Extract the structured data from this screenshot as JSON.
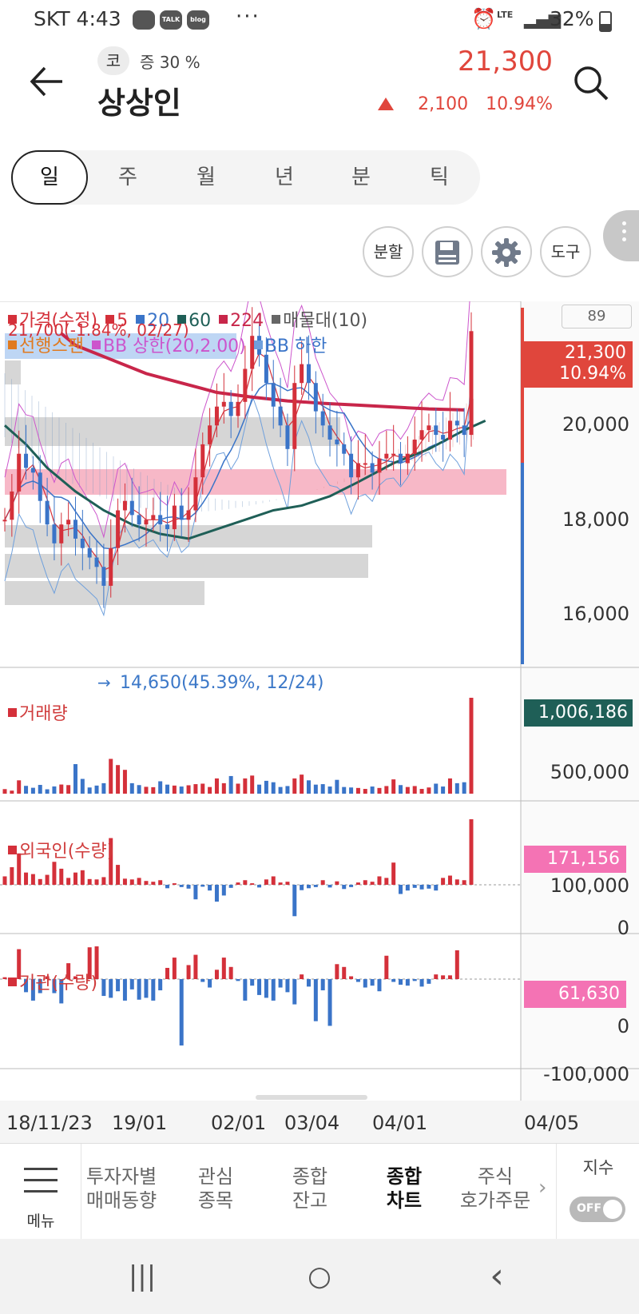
{
  "status_bar": {
    "carrier_time": "SKT 4:43",
    "icons": [
      "chat-icon",
      "kakaotalk-icon",
      "blog-icon",
      "more-icon",
      "alarm-icon",
      "lte-icon",
      "signal-icon",
      "battery-icon"
    ],
    "talk": "TALK",
    "blog": "blog",
    "dots": "···",
    "network": "LTE",
    "battery": "32%"
  },
  "header": {
    "market_badge": "코",
    "margin_text": "증 30 %",
    "stock_name": "상상인",
    "price": "21,300",
    "change": "2,100",
    "change_pct": "10.94%",
    "accent_color": "#e0463c"
  },
  "period_tabs": [
    {
      "label": "일",
      "active": true
    },
    {
      "label": "주",
      "active": false
    },
    {
      "label": "월",
      "active": false
    },
    {
      "label": "년",
      "active": false
    },
    {
      "label": "분",
      "active": false
    },
    {
      "label": "틱",
      "active": false
    }
  ],
  "tools": {
    "split": "분할",
    "save_icon": "save-icon",
    "settings_icon": "gear-icon",
    "tool": "도구"
  },
  "chart": {
    "period_count": "89",
    "legend": {
      "price": "가격(수정)",
      "ma5": "5",
      "ma20": "20",
      "ma60": "60",
      "ma224": "224",
      "volume_profile": "매물대(10)",
      "leading_span": "선행스팬",
      "bb_upper": "BB 상한(20,2.00)",
      "bb_lower": "BB 하한",
      "high_marker": "21,700(-1.84%, 02/27)"
    },
    "low_marker": "14,650(45.39%, 12/24)",
    "price_tag": {
      "price": "21,300",
      "pct": "10.94%"
    },
    "price_axis": [
      "20,000",
      "18,000",
      "16,000"
    ],
    "volume_title": "거래량",
    "volume_tag": "1,006,186",
    "volume_axis": [
      "500,000"
    ],
    "foreign_title": "외국인(수량)",
    "foreign_tag": "171,156",
    "foreign_axis": [
      "100,000",
      "0"
    ],
    "inst_title": "기관(수량)",
    "inst_tag": "61,630",
    "inst_axis": [
      "0",
      "-100,000"
    ],
    "dates": [
      "18/11/23",
      "19/01",
      "02/01",
      "03/04",
      "04/01",
      "04/05"
    ]
  },
  "chart_data": {
    "type": "bar",
    "price_range": [
      14500,
      22500
    ],
    "closes": [
      17300,
      17900,
      18700,
      18400,
      18300,
      17700,
      17200,
      16800,
      17200,
      17300,
      16900,
      16700,
      16500,
      16300,
      15900,
      16700,
      17500,
      17700,
      17400,
      17200,
      17300,
      17400,
      17200,
      17100,
      17600,
      17300,
      17500,
      18200,
      18900,
      19300,
      19700,
      19800,
      19500,
      19800,
      20500,
      21200,
      20800,
      20200,
      19700,
      19300,
      18800,
      20200,
      20600,
      20200,
      19600,
      19300,
      19000,
      18900,
      18700,
      18200,
      18500,
      18500,
      18300,
      18600,
      18700,
      18700,
      18500,
      18700,
      19000,
      19200,
      19300,
      19100,
      19000,
      19400,
      19300,
      19100,
      21300
    ],
    "volume": [
      48000,
      32000,
      140000,
      82000,
      62000,
      92000,
      46000,
      76000,
      96000,
      90000,
      310000,
      155000,
      65000,
      85000,
      110000,
      365000,
      300000,
      250000,
      110000,
      90000,
      72000,
      68000,
      130000,
      95000,
      85000,
      75000,
      88000,
      100000,
      105000,
      70000,
      160000,
      110000,
      185000,
      105000,
      160000,
      190000,
      95000,
      135000,
      120000,
      70000,
      80000,
      160000,
      200000,
      140000,
      95000,
      100000,
      75000,
      145000,
      70000,
      65000,
      60000,
      50000,
      75000,
      60000,
      80000,
      150000,
      90000,
      70000,
      80000,
      50000,
      65000,
      105000,
      75000,
      160000,
      110000,
      120000,
      1006186
    ],
    "foreign": [
      22000,
      46000,
      82000,
      32000,
      28000,
      15000,
      26000,
      60000,
      42000,
      18000,
      32000,
      38000,
      15000,
      14000,
      20000,
      122000,
      52000,
      16000,
      14000,
      18000,
      10000,
      8000,
      12000,
      -9000,
      4000,
      -6000,
      -10000,
      -38000,
      -5000,
      -15000,
      -44000,
      -28000,
      -8000,
      6000,
      12000,
      4000,
      -7000,
      14000,
      22000,
      6000,
      8000,
      -82000,
      -14000,
      -9000,
      -6000,
      12000,
      -7000,
      9000,
      -11000,
      -6000,
      6000,
      12000,
      8000,
      22000,
      18000,
      58000,
      -24000,
      -15000,
      -8000,
      -12000,
      -10000,
      -15000,
      18000,
      24000,
      14000,
      12000,
      171156
    ],
    "institution": [
      4000,
      -9000,
      64000,
      -28000,
      -46000,
      -30000,
      6000,
      -30000,
      -52000,
      34000,
      6000,
      2000,
      68000,
      70000,
      -36000,
      -40000,
      -26000,
      -46000,
      -22000,
      -44000,
      -40000,
      -46000,
      -24000,
      24000,
      46000,
      -142000,
      30000,
      52000,
      -6000,
      -18000,
      20000,
      46000,
      26000,
      -4000,
      -46000,
      -14000,
      -34000,
      -40000,
      -46000,
      -18000,
      -28000,
      -54000,
      10000,
      -16000,
      -90000,
      -24000,
      -100000,
      32000,
      26000,
      6000,
      -6000,
      -18000,
      -14000,
      -26000,
      50000,
      -6000,
      -12000,
      -14000,
      -4000,
      -16000,
      -10000,
      10000,
      8000,
      8000,
      61630
    ],
    "ma224_points": [
      [
        8,
        21250
      ],
      [
        10,
        21000
      ],
      [
        15,
        20700
      ],
      [
        20,
        20400
      ],
      [
        25,
        20200
      ],
      [
        30,
        20000
      ],
      [
        35,
        19900
      ],
      [
        40,
        19820
      ],
      [
        45,
        19770
      ],
      [
        50,
        19730
      ],
      [
        55,
        19690
      ],
      [
        60,
        19650
      ],
      [
        65,
        19630
      ]
    ],
    "ma60_points": [
      [
        0,
        19300
      ],
      [
        3,
        18900
      ],
      [
        6,
        18400
      ],
      [
        10,
        17900
      ],
      [
        14,
        17500
      ],
      [
        18,
        17200
      ],
      [
        22,
        17000
      ],
      [
        26,
        16900
      ],
      [
        30,
        17100
      ],
      [
        34,
        17300
      ],
      [
        38,
        17500
      ],
      [
        42,
        17600
      ],
      [
        46,
        17800
      ],
      [
        50,
        18100
      ],
      [
        55,
        18500
      ],
      [
        60,
        18800
      ],
      [
        65,
        19200
      ],
      [
        68,
        19400
      ]
    ],
    "colors": {
      "up": "#d4303a",
      "down": "#3a74c8",
      "ma5": "#d4303a",
      "ma20": "#3a74c8",
      "ma60": "#1f5f57",
      "ma224": "#c8264a",
      "bb": "#cc55cc",
      "volume_profile": "#c8c8c8",
      "volume_profile_poc": "#f4a0b4",
      "volume_profile_top": "#a8c8f0"
    }
  },
  "bottom_nav": {
    "menu": "메뉴",
    "items": [
      {
        "line1": "투자자별",
        "line2": "매매동향",
        "active": false
      },
      {
        "line1": "관심",
        "line2": "종목",
        "active": false
      },
      {
        "line1": "종합",
        "line2": "잔고",
        "active": false
      },
      {
        "line1": "종합",
        "line2": "차트",
        "active": true
      },
      {
        "line1": "주식",
        "line2": "호가주문",
        "active": false
      }
    ],
    "index_label": "지수",
    "toggle": "OFF"
  },
  "system_nav": {
    "recent": "|||",
    "home": "○",
    "back": "‹"
  }
}
